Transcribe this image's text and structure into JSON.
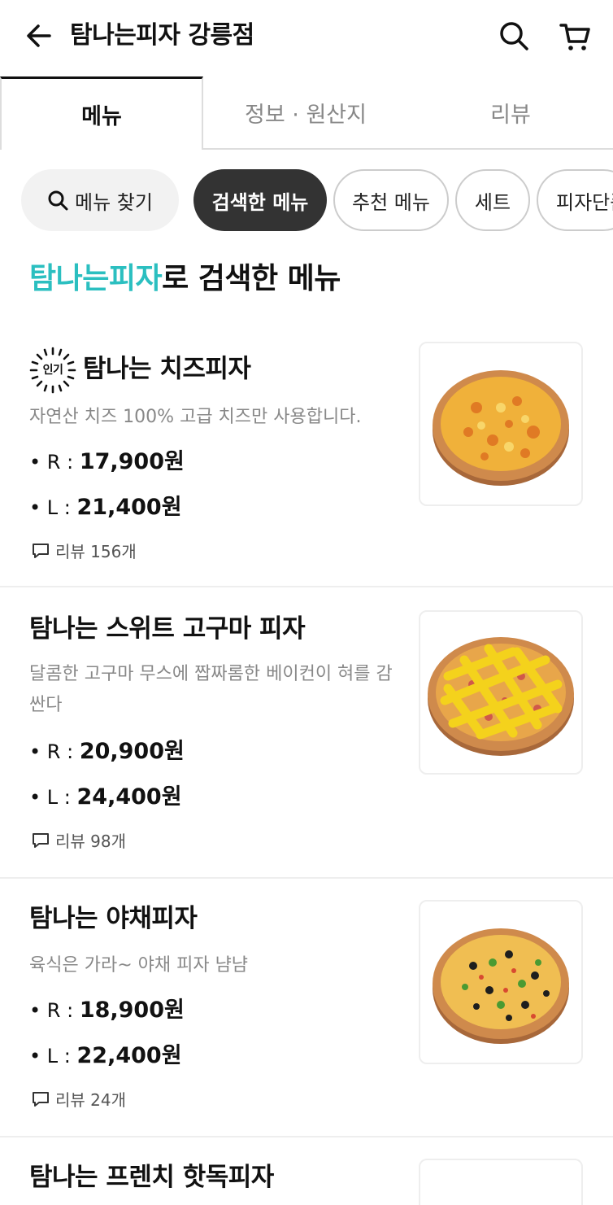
{
  "header": {
    "title": "탐나는피자 강릉점"
  },
  "tabs": [
    {
      "label": "메뉴",
      "active": true
    },
    {
      "label": "정보 · 원산지",
      "active": false
    },
    {
      "label": "리뷰",
      "active": false
    }
  ],
  "chips": {
    "search_label": "메뉴 찾기",
    "items": [
      "검색한 메뉴",
      "추천 메뉴",
      "세트",
      "피자단품"
    ]
  },
  "section": {
    "highlight": "탐나는피자",
    "rest": "로 검색한 메뉴"
  },
  "menu_items": [
    {
      "badge": "인기",
      "name": "탐나는 치즈피자",
      "description": "자연산 치즈 100%  고급 치즈만 사용합니다.",
      "price_r_label": "• R : ",
      "price_r": "17,900원",
      "price_l_label": "• L : ",
      "price_l": "21,400원",
      "review": "리뷰 156개"
    },
    {
      "name": "탐나는 스위트 고구마 피자",
      "description": "달콤한 고구마 무스에 짭짜롬한 베이컨이 혀를 감싼다",
      "price_r_label": "• R : ",
      "price_r": "20,900원",
      "price_l_label": "• L : ",
      "price_l": "24,400원",
      "review": "리뷰 98개"
    },
    {
      "name": "탐나는 야채피자",
      "description": "육식은 가라~ 야채 피자 냠냠",
      "price_r_label": "• R : ",
      "price_r": "18,900원",
      "price_l_label": "• L : ",
      "price_l": "22,400원",
      "review": "리뷰 24개"
    },
    {
      "name": "탐나는 프렌치 핫독피자"
    }
  ],
  "colors": {
    "accent": "#2bbfc0",
    "active_chip": "#333333"
  },
  "icons": {
    "back": "arrow-left-icon",
    "search": "search-icon",
    "cart": "cart-icon",
    "review": "speech-bubble-icon"
  }
}
